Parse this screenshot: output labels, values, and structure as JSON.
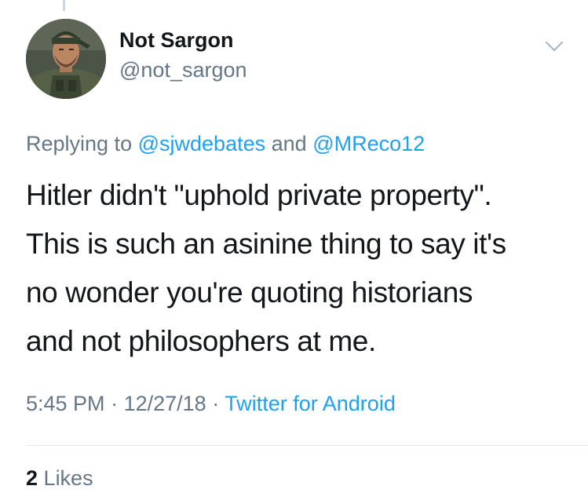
{
  "tweet": {
    "author": {
      "display_name": "Not Sargon",
      "handle": "@not_sargon",
      "avatar_icon": "soldier-avatar"
    },
    "replying_prefix": "Replying to",
    "replying_mention_1": "@sjwdebates",
    "replying_and": "and",
    "replying_mention_2": "@MReco12",
    "lines": [
      "Hitler didn't \"uphold private property\".",
      "This is such an asinine thing to say it's",
      "no wonder you're quoting historians",
      "and not philosophers at me."
    ],
    "time": "5:45 PM",
    "date": "12/27/18",
    "separator": "·",
    "source": "Twitter for Android",
    "likes_count": "2",
    "likes_label": "Likes",
    "more_icon": "chevron-down-icon"
  },
  "colors": {
    "text": "#14171a",
    "secondary": "#657786",
    "link": "#1da1f2",
    "divider": "#e1e8ed"
  }
}
